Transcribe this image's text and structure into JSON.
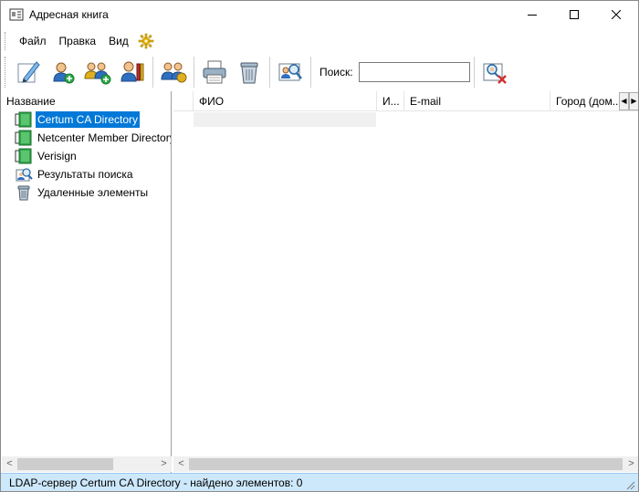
{
  "window": {
    "title": "Адресная книга"
  },
  "menu": {
    "items": [
      "Файл",
      "Правка",
      "Вид"
    ]
  },
  "toolbar": {
    "buttons": [
      "new-contact-icon",
      "new-user-icon",
      "new-group-icon",
      "properties-icon",
      "find-people-icon",
      "print-icon",
      "delete-icon",
      "search-directory-icon",
      "contact-remove-icon"
    ],
    "search": {
      "label": "Поиск:",
      "value": ""
    }
  },
  "left": {
    "header": "Название",
    "items": [
      {
        "label": "Certum CA Directory",
        "icon": "directory-icon",
        "selected": true
      },
      {
        "label": "Netcenter Member Directory",
        "icon": "directory-icon",
        "selected": false
      },
      {
        "label": "Verisign",
        "icon": "directory-icon",
        "selected": false
      },
      {
        "label": "Результаты поиска",
        "icon": "search-results-icon",
        "selected": false
      },
      {
        "label": "Удаленные элементы",
        "icon": "trash-icon",
        "selected": false
      }
    ]
  },
  "right": {
    "columns": [
      "ФИО",
      "И...",
      "E-mail",
      "Город (дом..."
    ]
  },
  "status": {
    "text": "LDAP-сервер Certum CA Directory - найдено элементов: 0"
  },
  "colors": {
    "selection": "#0078d7",
    "status_bg": "#cde8fb",
    "directory_green": "#2fa84a"
  }
}
